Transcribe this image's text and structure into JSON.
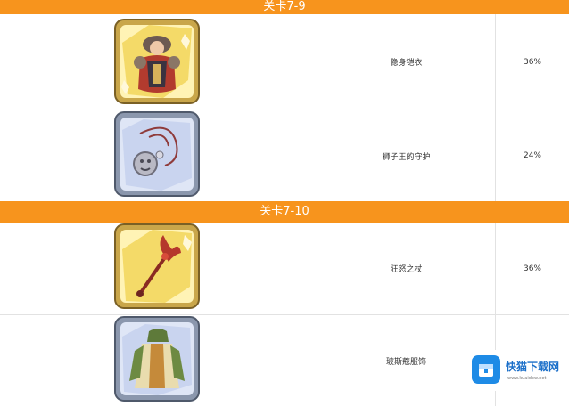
{
  "sections": [
    {
      "title": "关卡7-9",
      "rows": [
        {
          "name": "隐身铠衣",
          "rate": "36%",
          "icon": "armor-icon"
        },
        {
          "name": "狮子王的守护",
          "rate": "24%",
          "icon": "lion-amulet-icon"
        }
      ]
    },
    {
      "title": "关卡7-10",
      "rows": [
        {
          "name": "狂怒之杖",
          "rate": "36%",
          "icon": "staff-icon"
        },
        {
          "name": "玻斯蔻服饰",
          "rate": "",
          "icon": "robe-icon"
        }
      ]
    }
  ],
  "watermark": {
    "title": "快猫下载网",
    "url": "www.kuaidow.net"
  },
  "colors": {
    "band": "#f7941d",
    "gold_frame": "#c9a64a",
    "blue_frame": "#8b97ad"
  }
}
